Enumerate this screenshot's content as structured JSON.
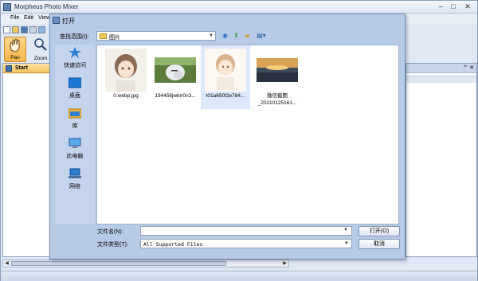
{
  "app": {
    "title": "Morpheus Photo Mixer",
    "minimize": "–",
    "maximize": "□",
    "close": "✕",
    "menu": [
      "File",
      "Edit",
      "View"
    ],
    "tools": {
      "pan": "Pan",
      "zoom": "Zoom"
    },
    "start_tab": "Start",
    "panel_pin": "ꟸ",
    "panel_close": "✕"
  },
  "dialog": {
    "title": "打开",
    "close": "✕",
    "look_in_label": "查找范围(I):",
    "look_in_value": "图片",
    "places": [
      {
        "label": "快速访问",
        "icon": "star-icon"
      },
      {
        "label": "桌面",
        "icon": "desktop-icon"
      },
      {
        "label": "库",
        "icon": "library-icon"
      },
      {
        "label": "此电脑",
        "icon": "computer-icon"
      },
      {
        "label": "网络",
        "icon": "network-icon"
      }
    ],
    "files": [
      {
        "name": "0.webp.jpg",
        "thumb": "anime-boy-portrait"
      },
      {
        "name": "194458jwktr0n3...",
        "thumb": "white-tiger-photo"
      },
      {
        "name": "t01a650f2e784...",
        "thumb": "anime-sketch-portrait"
      },
      {
        "name": "微信截图_20210125161...",
        "name_line1": "微信截图",
        "name_line2": "_20210125161...",
        "thumb": "landscape-photo"
      }
    ],
    "file_name_label": "文件名(N):",
    "file_name_value": "",
    "file_type_label": "文件类型(T):",
    "file_type_value": "All Supported Files",
    "open_button": "打开(O)",
    "cancel_button": "取消"
  },
  "colors": {
    "dialog_bg": "#b7cbe6",
    "selection": "#dbe9fb",
    "pan_active": "#f7b54a"
  }
}
